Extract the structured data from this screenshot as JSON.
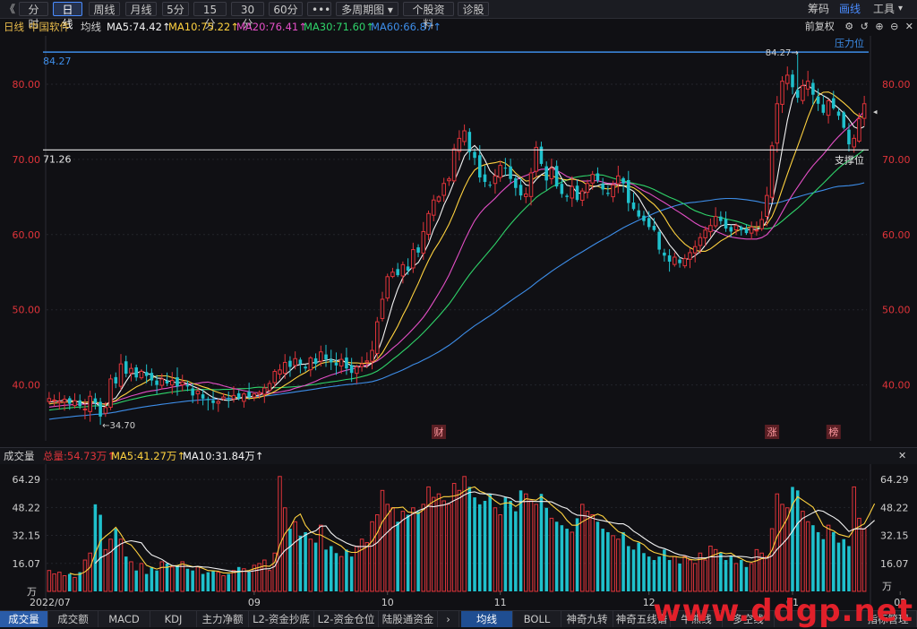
{
  "toolbar": {
    "back": "《",
    "buttons": [
      "分时",
      "日线",
      "周线",
      "月线",
      "5分",
      "15分",
      "30分",
      "60分",
      "•••",
      "多周期图 ▾",
      "个股资料",
      "诊股"
    ],
    "active": "日线",
    "right": {
      "code": "筹码",
      "draw": "画线",
      "tools": "工具",
      "dropdown": "▾"
    }
  },
  "legend": {
    "period": "日线",
    "name": "中国软件",
    "type": "均线",
    "ma5": "MA5:74.42↑",
    "ma10": "MA10:75.22↑",
    "ma20": "MA20:76.41↑",
    "ma30": "MA30:71.60↑",
    "ma60": "MA60:66.87↑",
    "adjust": "前复权"
  },
  "vol_legend": {
    "title": "成交量",
    "total": "总量:54.73万↑",
    "ma5": "MA5:41.27万↑",
    "ma10": "MA10:31.84万↑"
  },
  "bottom_tabs": [
    "成交量",
    "成交额",
    "MACD",
    "KDJ",
    "主力净额",
    "L2-资金抄底",
    "L2-资金仓位",
    "陆股通资金",
    "›",
    "均线",
    "BOLL",
    "神奇九转",
    "神奇五线谱",
    "牛熊线",
    "多空线",
    "指标管理"
  ],
  "watermark": "www.ddgp.net",
  "colors": {
    "up": "#e0343a",
    "down": "#1fc0cc",
    "ma5": "#f2f2f2",
    "ma10": "#ffd23f",
    "ma20": "#e44fc6",
    "ma30": "#2fd46a",
    "ma60": "#3d8de8",
    "resistance": "#3d8de8",
    "support": "#e8e8e8"
  },
  "chart_data": [
    {
      "type": "candlestick",
      "price_axis": {
        "ylim": [
          34,
          85
        ],
        "ticks": [
          "80.00",
          "70.00",
          "60.00",
          "50.00",
          "40.00"
        ]
      },
      "x_ticks": [
        "2022/07",
        "09",
        "10",
        "11",
        "12",
        "01",
        "02"
      ],
      "resistance": {
        "label": "压力位",
        "value": 84.27,
        "value_label": "84.27"
      },
      "support": {
        "label": "支撑位",
        "value": 71.26,
        "value_label": "71.26"
      },
      "high_mark": "84.27→",
      "low_mark": "←34.70",
      "event_markers": [
        "财",
        "涨",
        "榜"
      ],
      "candles_note": "approximate daily OHLC read from chart",
      "closes": [
        38.2,
        38.0,
        37.8,
        38.1,
        37.5,
        37.9,
        37.2,
        36.8,
        38.5,
        37.6,
        35.8,
        37.0,
        40.8,
        40.2,
        42.8,
        41.5,
        42.2,
        41.0,
        41.8,
        41.2,
        40.6,
        40.0,
        40.8,
        40.2,
        40.6,
        39.8,
        40.4,
        39.8,
        38.6,
        39.2,
        38.2,
        38.0,
        37.6,
        37.8,
        38.4,
        38.0,
        38.6,
        38.2,
        38.8,
        38.4,
        38.8,
        39.0,
        39.6,
        40.2,
        41.8,
        42.0,
        43.0,
        42.4,
        43.5,
        42.8,
        42.2,
        43.6,
        42.8,
        44.4,
        43.4,
        43.0,
        42.6,
        43.4,
        42.2,
        41.6,
        42.4,
        42.8,
        43.2,
        44.6,
        48.4,
        51.4,
        54.4,
        55.0,
        54.6,
        56.0,
        55.2,
        58.0,
        57.6,
        60.4,
        62.8,
        64.6,
        65.0,
        66.8,
        67.4,
        71.4,
        72.8,
        73.8,
        71.0,
        70.2,
        67.6,
        67.0,
        66.6,
        67.8,
        69.2,
        68.8,
        67.4,
        66.2,
        65.2,
        65.4,
        68.2,
        71.6,
        69.4,
        67.2,
        68.8,
        66.4,
        65.4,
        65.0,
        66.4,
        64.6,
        65.8,
        66.8,
        68.0,
        67.2,
        66.0,
        65.4,
        66.6,
        67.8,
        66.8,
        64.2,
        63.4,
        62.4,
        61.8,
        61.0,
        60.6,
        58.0,
        57.2,
        56.4,
        57.0,
        56.2,
        56.8,
        57.6,
        58.4,
        59.6,
        60.6,
        61.2,
        62.4,
        61.8,
        60.8,
        60.4,
        61.2,
        60.6,
        60.2,
        61.0,
        60.6,
        62.0,
        65.2,
        71.8,
        77.4,
        80.4,
        81.2,
        79.6,
        78.2,
        79.8,
        80.4,
        78.6,
        77.4,
        76.2,
        77.8,
        76.8,
        75.8,
        74.2,
        72.0,
        72.8,
        75.4,
        77.4
      ],
      "moving_averages": [
        {
          "name": "MA5",
          "value": "74.42"
        },
        {
          "name": "MA10",
          "value": "75.22"
        },
        {
          "name": "MA20",
          "value": "76.41"
        },
        {
          "name": "MA30",
          "value": "71.60"
        },
        {
          "name": "MA60",
          "value": "66.87"
        }
      ]
    },
    {
      "type": "bar",
      "title": "成交量",
      "unit": "万",
      "ylim": [
        0,
        70
      ],
      "ticks": [
        "64.29",
        "48.22",
        "32.15",
        "16.07"
      ],
      "volumes": [
        12,
        10,
        11,
        9,
        10,
        8,
        11,
        18,
        22,
        50,
        44,
        24,
        30,
        36,
        30,
        20,
        17,
        12,
        16,
        10,
        14,
        12,
        17,
        16,
        14,
        15,
        17,
        13,
        12,
        14,
        10,
        11,
        12,
        11,
        9,
        10,
        12,
        14,
        13,
        11,
        15,
        16,
        18,
        12,
        22,
        66,
        48,
        36,
        40,
        32,
        34,
        30,
        28,
        38,
        24,
        26,
        22,
        20,
        24,
        20,
        26,
        30,
        28,
        40,
        44,
        58,
        50,
        48,
        40,
        46,
        44,
        48,
        46,
        50,
        60,
        54,
        56,
        52,
        50,
        62,
        58,
        66,
        60,
        54,
        50,
        52,
        56,
        48,
        44,
        54,
        52,
        46,
        58,
        56,
        52,
        50,
        56,
        48,
        42,
        40,
        38,
        36,
        34,
        42,
        50,
        46,
        44,
        40,
        36,
        34,
        32,
        30,
        34,
        26,
        24,
        28,
        22,
        20,
        18,
        20,
        24,
        18,
        20,
        16,
        20,
        18,
        16,
        22,
        18,
        26,
        24,
        22,
        18,
        20,
        16,
        18,
        14,
        16,
        24,
        22,
        20,
        36,
        56,
        50,
        48,
        60,
        58,
        46,
        40,
        38,
        34,
        30,
        38,
        34,
        28,
        30,
        26,
        60,
        42,
        36,
        58,
        56
      ]
    }
  ]
}
